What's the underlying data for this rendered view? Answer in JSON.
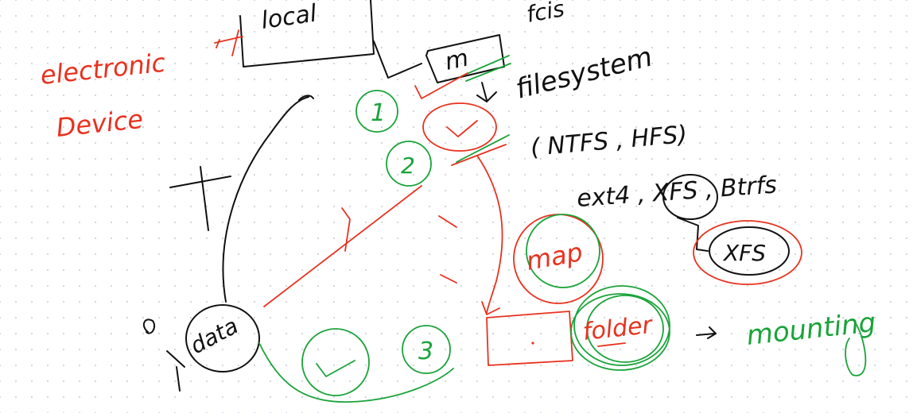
{
  "colors": {
    "ink_black": "#111111",
    "ink_red": "#e8321f",
    "ink_green": "#1aa33a",
    "background": "#ffffff",
    "grid_dot": "#cfd6df"
  },
  "labels": {
    "local": "local",
    "fs_abbrev": "fcis",
    "electronic": "electronic",
    "device": "Device",
    "filesystem": "filesystem",
    "fs_list_1": "( NTFS , HFS)",
    "fs_list_2": "ext4 , XFS , Btrfs",
    "xfs": "XFS",
    "data": "data",
    "map": "map",
    "folder": "folder",
    "mounting": "mounting",
    "step_1": "1",
    "step_2": "2",
    "step_3": "3"
  }
}
